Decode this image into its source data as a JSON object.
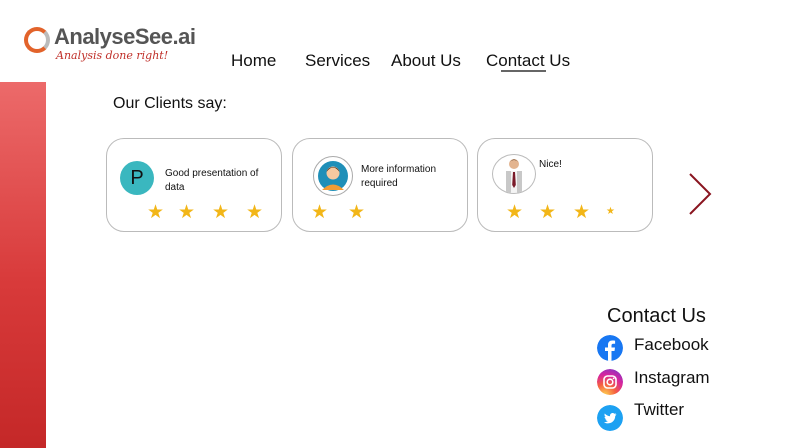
{
  "brand": {
    "name": "AnalyseSee.ai",
    "tagline": "Analysis done right!",
    "accent_color": "#c0302a"
  },
  "nav": {
    "items": [
      {
        "label": "Home"
      },
      {
        "label": "Services"
      },
      {
        "label": "About Us"
      },
      {
        "label": "Contact Us",
        "active": true
      }
    ]
  },
  "testimonials": {
    "title": "Our Clients say:",
    "cards": [
      {
        "avatar": "P",
        "avatar_icon": "letter-avatar",
        "comment": "Good presentation of data",
        "rating": 4
      },
      {
        "avatar_icon": "user-avatar-icon",
        "comment": "More information required",
        "rating": 2
      },
      {
        "avatar_icon": "businessman-avatar-icon",
        "comment": "Nice!",
        "rating": 3.5
      }
    ],
    "next_icon": "chevron-right-icon"
  },
  "contact": {
    "title": "Contact Us",
    "links": [
      {
        "label": "Facebook",
        "icon": "facebook-icon",
        "color": "#1877f2"
      },
      {
        "label": "Instagram",
        "icon": "instagram-icon",
        "color": "#d6249f"
      },
      {
        "label": "Twitter",
        "icon": "twitter-icon",
        "color": "#1da1f2"
      }
    ]
  }
}
